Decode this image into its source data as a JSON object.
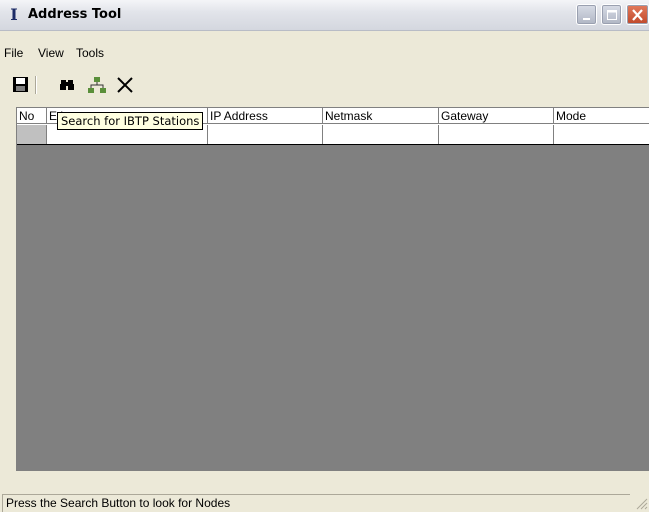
{
  "window": {
    "title": "Address Tool"
  },
  "icons": {
    "app": "I-logo-icon",
    "save": "floppy-disk-icon",
    "search": "binoculars-icon",
    "network": "network-nodes-icon",
    "delete": "x-cross-icon"
  },
  "menu": {
    "items": [
      "File",
      "View",
      "Tools"
    ]
  },
  "toolbar": {
    "tooltip": "Search for IBTP Stations"
  },
  "grid": {
    "columns": [
      "No",
      "Eth",
      "IP Address",
      "Netmask",
      "Gateway",
      "Mode"
    ]
  },
  "status": {
    "text": "Press the Search Button to look for Nodes"
  },
  "colors": {
    "grid_background": "#808080",
    "window_background": "#ECE9D8",
    "tooltip_background": "#FFFFE1"
  }
}
